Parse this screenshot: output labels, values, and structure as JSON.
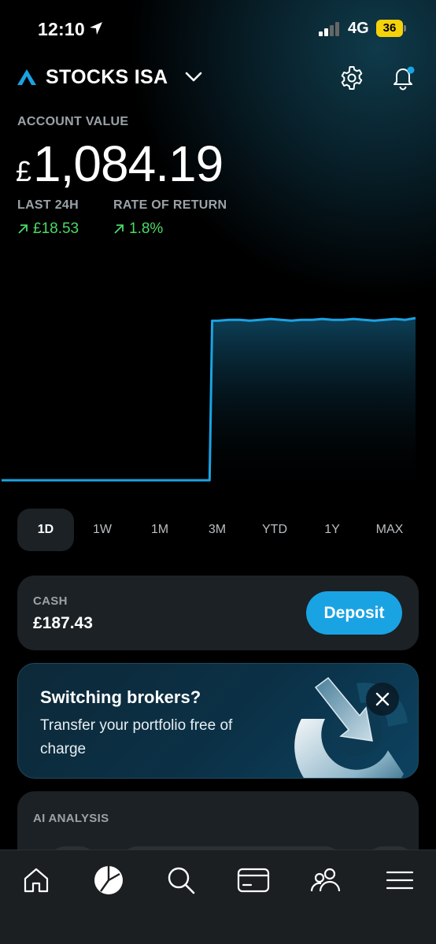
{
  "status_bar": {
    "time": "12:10",
    "network": "4G",
    "battery": "36"
  },
  "header": {
    "account_name": "STOCKS ISA"
  },
  "account": {
    "label": "ACCOUNT VALUE",
    "currency": "£",
    "value": "1,084.19",
    "last24h_label": "LAST 24H",
    "last24h_value": "£18.53",
    "return_label": "RATE OF RETURN",
    "return_value": "1.8%"
  },
  "chart_data": {
    "type": "line",
    "period": "1D",
    "x": [
      0,
      1,
      2,
      3,
      4,
      5,
      6,
      7,
      8,
      9,
      10,
      11,
      12,
      13,
      14,
      15,
      16,
      17,
      18,
      19,
      20,
      21,
      22,
      23,
      24,
      25,
      26,
      27,
      28,
      29,
      30,
      31,
      32,
      33,
      34,
      35,
      36,
      37,
      38,
      39,
      40
    ],
    "values": [
      1065.7,
      1065.7,
      1065.7,
      1065.7,
      1065.7,
      1065.7,
      1065.7,
      1065.7,
      1065.7,
      1065.7,
      1065.7,
      1065.7,
      1065.7,
      1065.7,
      1065.7,
      1065.7,
      1065.7,
      1065.7,
      1065.7,
      1065.7,
      1065.7,
      1084.0,
      1084.1,
      1084.1,
      1084.0,
      1084.1,
      1084.2,
      1084.1,
      1084.0,
      1084.1,
      1084.1,
      1084.2,
      1084.1,
      1084.1,
      1084.2,
      1084.1,
      1084.0,
      1084.1,
      1084.2,
      1084.1,
      1084.3
    ],
    "line_color": "#1aa3e3",
    "grid": false
  },
  "range_tabs": [
    "1D",
    "1W",
    "1M",
    "3M",
    "YTD",
    "1Y",
    "MAX"
  ],
  "active_range": "1D",
  "cash": {
    "label": "CASH",
    "amount": "£187.43",
    "deposit_label": "Deposit"
  },
  "promo": {
    "title": "Switching brokers?",
    "body": "Transfer your portfolio free of charge"
  },
  "ai_analysis": {
    "label": "AI ANALYSIS"
  },
  "bottom_nav": [
    {
      "icon": "home-icon"
    },
    {
      "icon": "portfolio-pie-icon",
      "active": true
    },
    {
      "icon": "search-icon"
    },
    {
      "icon": "card-icon"
    },
    {
      "icon": "community-icon"
    },
    {
      "icon": "menu-icon"
    }
  ],
  "colors": {
    "accent": "#1aa3e3",
    "positive": "#4cd964",
    "card_bg": "#1c2125"
  }
}
